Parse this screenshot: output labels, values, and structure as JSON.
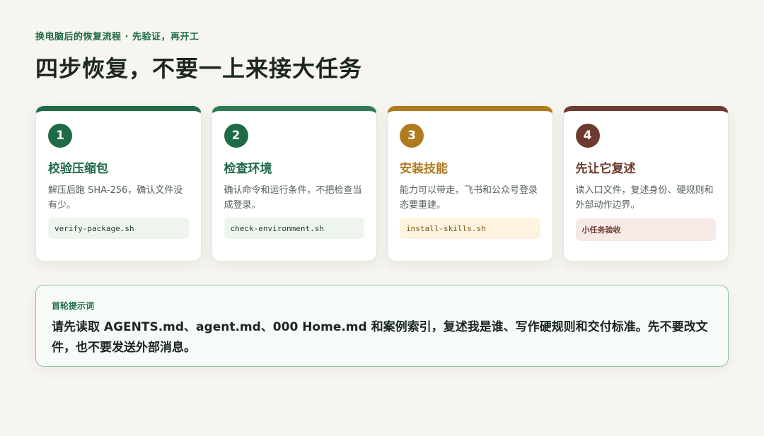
{
  "header": {
    "eyebrow": "换电脑后的恢复流程 · 先验证，再开工",
    "title": "四步恢复，不要一上来接大任务"
  },
  "colors": {
    "step1": "#1e6b47",
    "step2": "#2e7d52",
    "step3": "#b07a1e",
    "step4": "#6e3a30"
  },
  "steps": [
    {
      "number": "1",
      "title": "校验压缩包",
      "description": "解压后跑 SHA-256，确认文件没有少。",
      "tag": "verify-package.sh"
    },
    {
      "number": "2",
      "title": "检查环境",
      "description": "确认命令和运行条件，不把检查当成登录。",
      "tag": "check-environment.sh"
    },
    {
      "number": "3",
      "title": "安装技能",
      "description": "能力可以带走，飞书和公众号登录态要重建。",
      "tag": "install-skills.sh"
    },
    {
      "number": "4",
      "title": "先让它复述",
      "description": "读入口文件，复述身份、硬规则和外部动作边界。",
      "tag": "小任务验收"
    }
  ],
  "prompt": {
    "label": "首轮提示词",
    "text": "请先读取 AGENTS.md、agent.md、000 Home.md 和案例索引，复述我是谁、写作硬规则和交付标准。先不要改文件，也不要发送外部消息。"
  }
}
